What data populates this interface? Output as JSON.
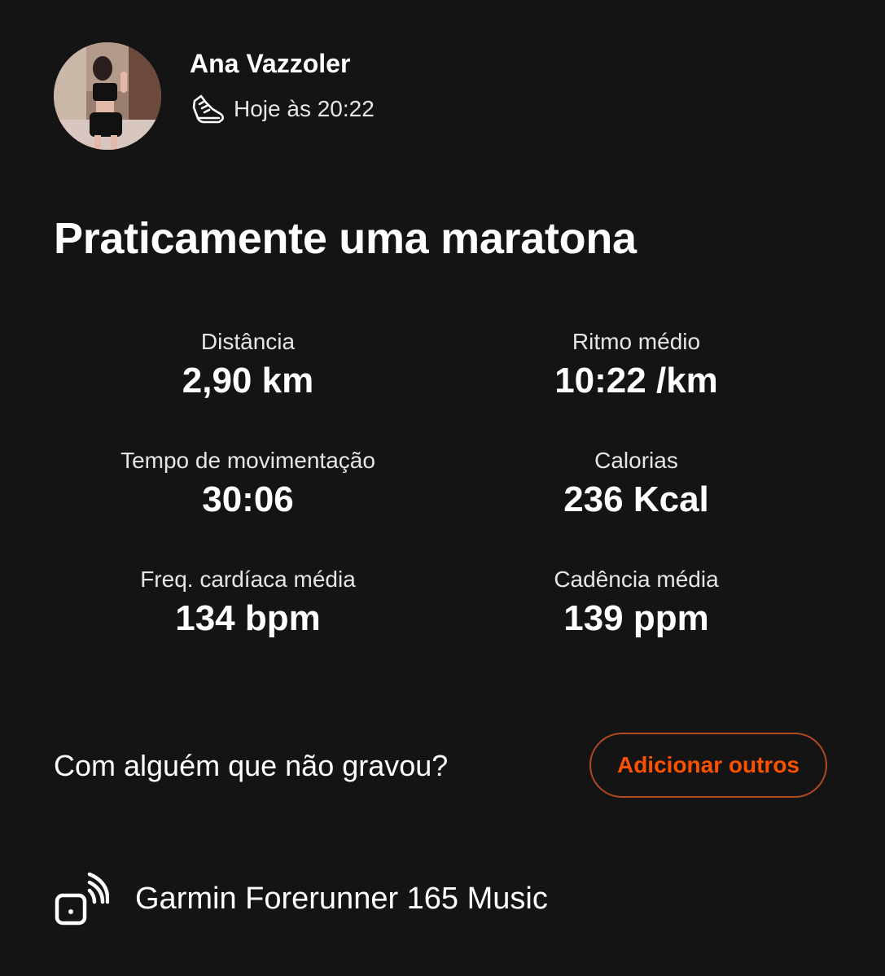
{
  "activity": {
    "athlete_name": "Ana Vazzoler",
    "sport_icon": "running-shoe-icon",
    "timestamp": "Hoje às 20:22",
    "title": "Praticamente uma maratona"
  },
  "stats": [
    {
      "label": "Distância",
      "value": "2,90 km"
    },
    {
      "label": "Ritmo médio",
      "value": "10:22 /km"
    },
    {
      "label": "Tempo de movimentação",
      "value": "30:06"
    },
    {
      "label": "Calorias",
      "value": "236 Kcal"
    },
    {
      "label": "Freq. cardíaca média",
      "value": "134 bpm"
    },
    {
      "label": "Cadência média",
      "value": "139 ppm"
    }
  ],
  "group": {
    "prompt": "Com alguém que não gravou?",
    "button_label": "Adicionar outros"
  },
  "device": {
    "icon": "connected-device-icon",
    "name": "Garmin Forerunner 165 Music"
  },
  "colors": {
    "background": "#151414",
    "text": "#ffffff",
    "accent": "#fc5200",
    "button_border": "#b04a1f"
  }
}
